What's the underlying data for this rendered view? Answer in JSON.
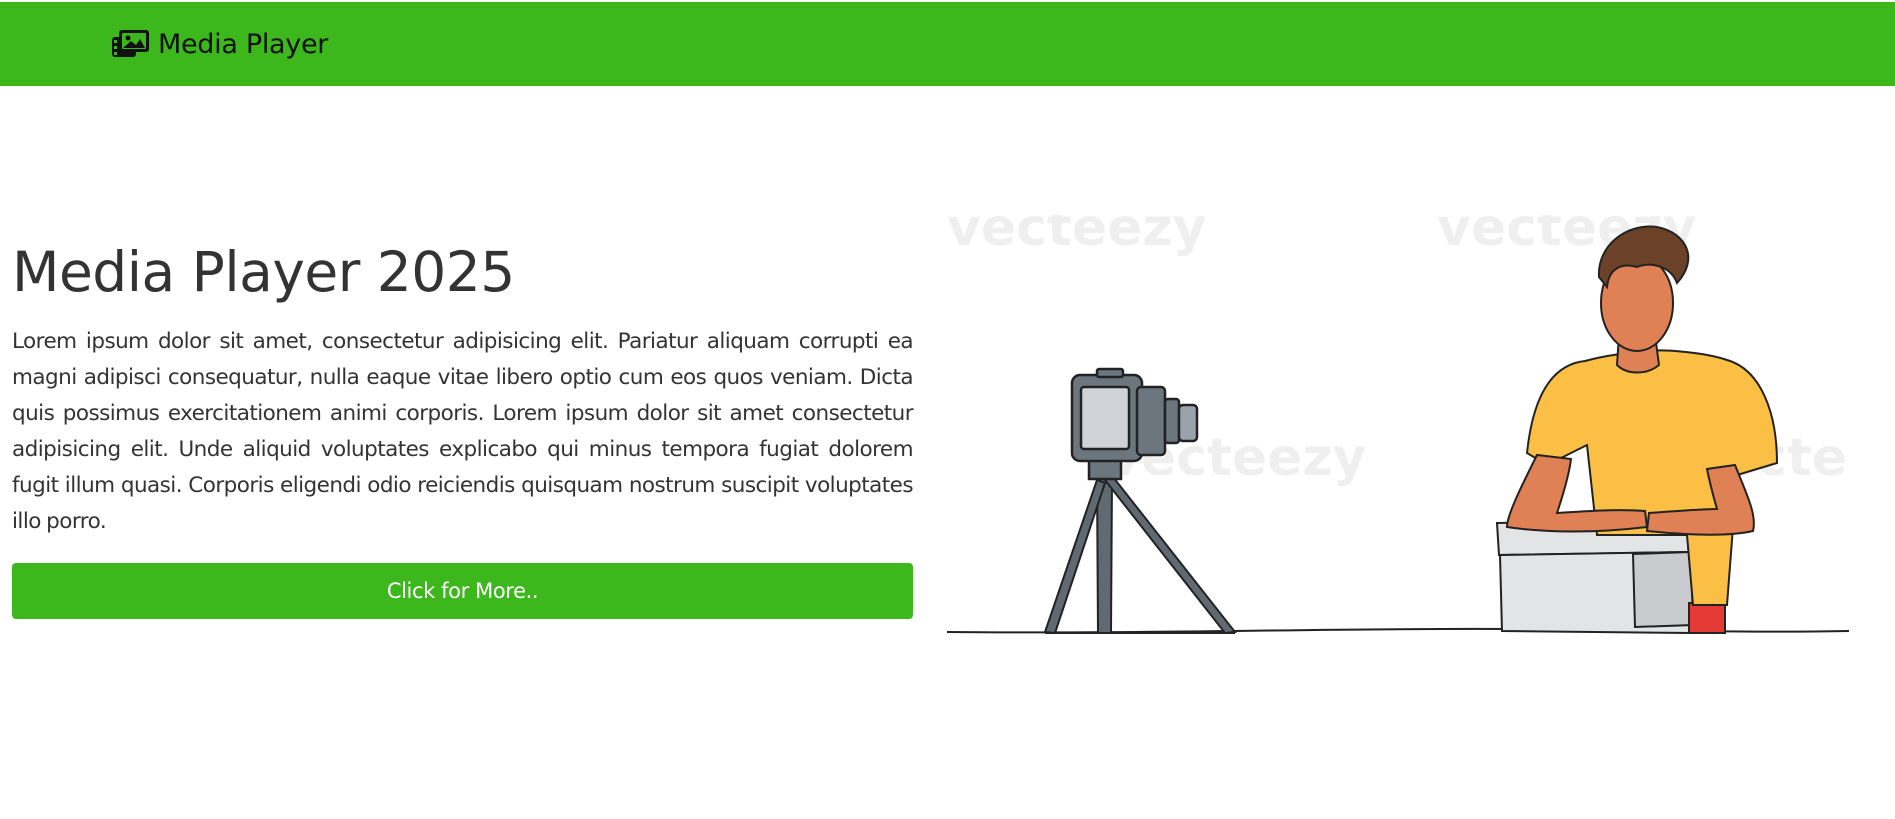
{
  "navbar": {
    "brand_label": "Media Player",
    "brand_icon": "images-icon",
    "background_color": "#3cb71c"
  },
  "hero": {
    "title": "Media Player 2025",
    "description": "Lorem ipsum dolor sit amet, consectetur adipisicing elit. Pariatur aliquam corrupti ea magni adipisci consequatur, nulla eaque vitae libero optio cum eos quos veniam. Dicta quis possimus exercitationem animi corporis. Lorem ipsum dolor sit amet consectetur adipisicing elit. Unde aliquid voluptates explicabo qui minus tempora fugiat dolorem fugit illum quasi. Corporis eligendi odio reiciendis quisquam nostrum suscipit voluptates illo porro.",
    "button_label": "Click for More..",
    "button_color": "#3cb71c"
  },
  "illustration": {
    "subject": "man-recording-video-icon",
    "watermark_text": "vecteezy"
  }
}
